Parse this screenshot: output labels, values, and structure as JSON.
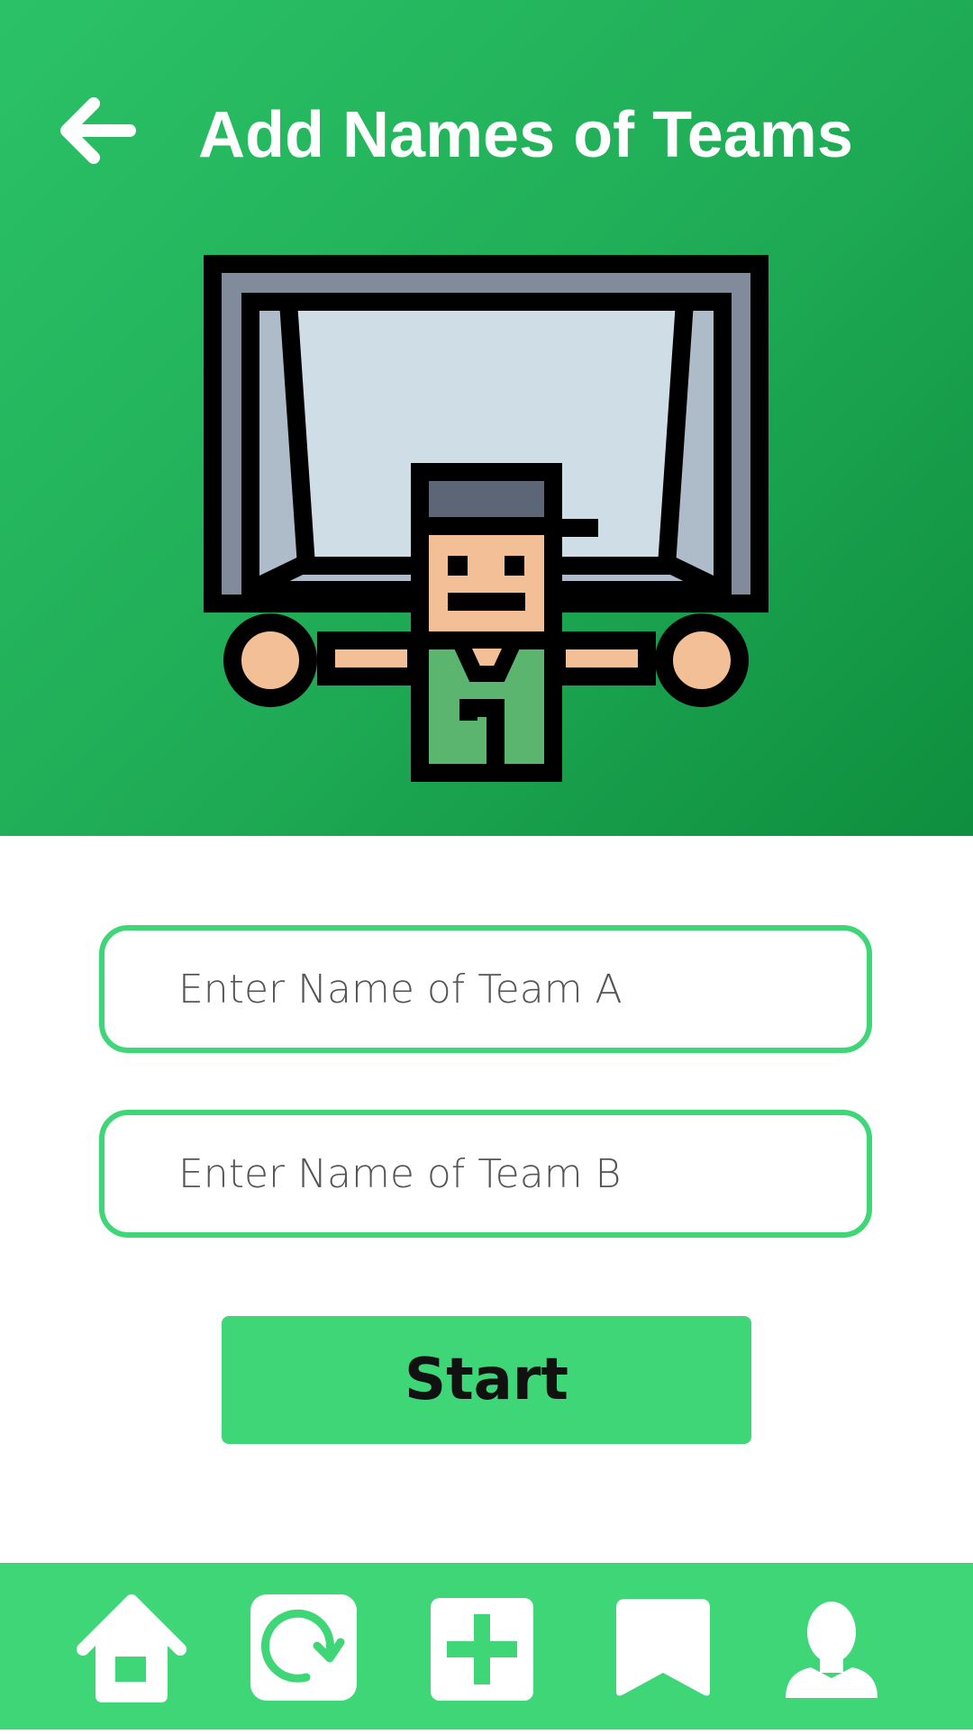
{
  "header": {
    "title": "Add Names of Teams",
    "back_icon": "arrow-left-icon",
    "hero_icon": "goalkeeper-illustration"
  },
  "form": {
    "team_a": {
      "placeholder": "Enter Name of Team A",
      "value": ""
    },
    "team_b": {
      "placeholder": "Enter Name of Team B",
      "value": ""
    },
    "start_label": "Start"
  },
  "bottom_nav": {
    "items": [
      {
        "icon": "home-icon"
      },
      {
        "icon": "history-icon"
      },
      {
        "icon": "add-icon"
      },
      {
        "icon": "bookmark-icon"
      },
      {
        "icon": "profile-icon"
      }
    ]
  },
  "colors": {
    "header_gradient_start": "#2bc267",
    "header_gradient_end": "#0e8e3e",
    "accent": "#3ed677",
    "white": "#ffffff",
    "text_dark": "#111111"
  }
}
